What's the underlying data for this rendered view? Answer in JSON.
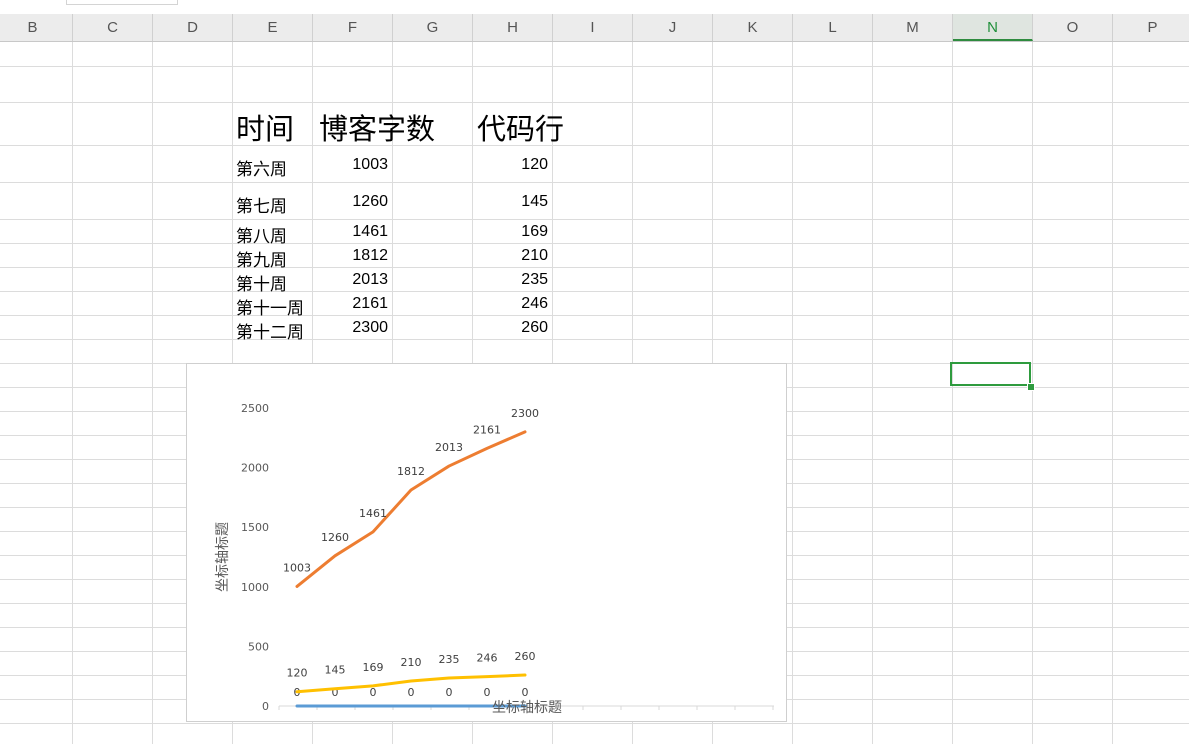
{
  "columns": [
    "B",
    "C",
    "D",
    "E",
    "F",
    "G",
    "H",
    "I",
    "J",
    "K",
    "L",
    "M",
    "N",
    "O",
    "P"
  ],
  "active_column": "N",
  "table": {
    "headers": {
      "time": "时间",
      "words": "博客字数",
      "lines": "代码行"
    },
    "rows": [
      {
        "week": "第六周",
        "words": "1003",
        "lines": "120"
      },
      {
        "week": "第七周",
        "words": "1260",
        "lines": "145"
      },
      {
        "week": "第八周",
        "words": "1461",
        "lines": "169"
      },
      {
        "week": "第九周",
        "words": "1812",
        "lines": "210"
      },
      {
        "week": "第十周",
        "words": "2013",
        "lines": "235"
      },
      {
        "week": "第十一周",
        "words": "2161",
        "lines": "246"
      },
      {
        "week": "第十二周",
        "words": "2300",
        "lines": "260"
      }
    ]
  },
  "chart_data": {
    "type": "line",
    "xlabel": "坐标轴标题",
    "ylabel": "坐标轴标题",
    "ylim": [
      0,
      2500
    ],
    "yticks": [
      "0",
      "500",
      "1000",
      "1500",
      "2000",
      "2500"
    ],
    "grid": false,
    "series": [
      {
        "values": [
          0,
          0,
          0,
          0,
          0,
          0,
          0
        ],
        "labels": [
          "0",
          "0",
          "0",
          "0",
          "0",
          "0",
          "0"
        ],
        "color": "#5b9bd5"
      },
      {
        "values": [
          1003,
          1260,
          1461,
          1812,
          2013,
          2161,
          2300
        ],
        "labels": [
          "1003",
          "1260",
          "1461",
          "1812",
          "2013",
          "2161",
          "2300"
        ],
        "color": "#ed7d31"
      },
      {
        "values": [
          120,
          145,
          169,
          210,
          235,
          246,
          260
        ],
        "labels": [
          "120",
          "145",
          "169",
          "210",
          "235",
          "246",
          "260"
        ],
        "color": "#ffc000"
      }
    ]
  }
}
